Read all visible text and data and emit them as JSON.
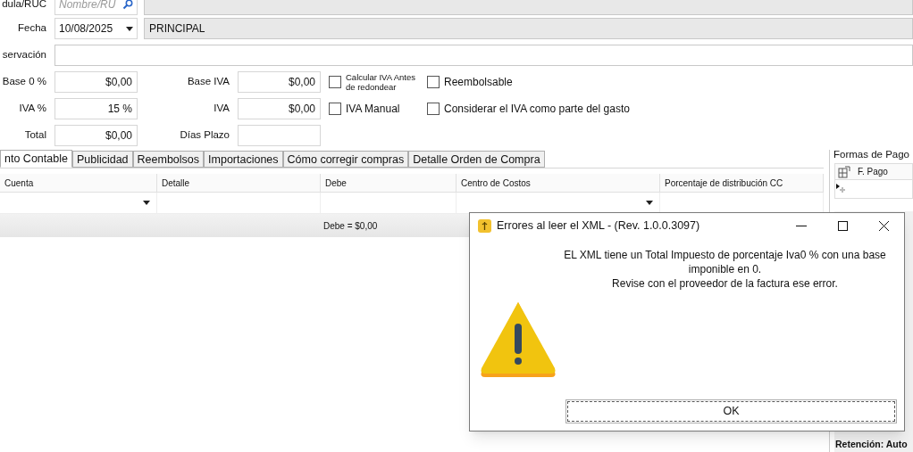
{
  "ruc": {
    "label": "dula/RUC",
    "placeholder": "Nombre/RU"
  },
  "fecha": {
    "label": "Fecha",
    "value": "10/08/2025",
    "branch": "PRINCIPAL"
  },
  "observacion": {
    "label": "servación"
  },
  "amounts": [
    {
      "label": "Base 0 %",
      "value": "$0,00"
    },
    {
      "label": "IVA %",
      "value": "15 %"
    },
    {
      "label": "Total",
      "value": "$0,00"
    }
  ],
  "amounts2": [
    {
      "label": "Base IVA",
      "value": "$0,00"
    },
    {
      "label": "IVA",
      "value": "$0,00"
    },
    {
      "label": "Días Plazo"
    }
  ],
  "checks": [
    {
      "label": "Calcular IVA Antes de redondear",
      "checked": false,
      "kind": "small"
    },
    {
      "label": "Reembolsable",
      "checked": false,
      "kind": "normal"
    },
    {
      "label": "IVA Manual",
      "checked": false,
      "kind": "normal"
    },
    {
      "label": "Considerar el IVA como parte del gasto",
      "checked": false,
      "kind": "normal"
    }
  ],
  "tabs": [
    {
      "label": "nto Contable",
      "selected": true
    },
    {
      "label": "Publicidad",
      "selected": false
    },
    {
      "label": "Reembolsos",
      "selected": false
    },
    {
      "label": "Importaciones",
      "selected": false
    },
    {
      "label": "Cómo corregir compras",
      "selected": false
    },
    {
      "label": "Detalle Orden de Compra",
      "selected": false
    }
  ],
  "grid": {
    "columns": [
      {
        "label": "Cuenta",
        "kind": "combo"
      },
      {
        "label": "Detalle",
        "kind": "text"
      },
      {
        "label": "Debe",
        "kind": "text"
      },
      {
        "label": "Centro de Costos",
        "kind": "combo"
      },
      {
        "label": "Porcentaje de distribución CC",
        "kind": "text"
      }
    ],
    "footer": "Debe = $0,00"
  },
  "payments": {
    "title": "Formas de Pago",
    "column": "F. Pago",
    "retention": "Retención: Auto"
  },
  "dialog": {
    "title": "Errores al leer el XML - (Rev. 1.0.0.3097)",
    "message": [
      "EL XML tiene un Total Impuesto de porcentaje Iva0 % con una base",
      "imponible en 0.",
      "Revise con el proveedor de la factura ese error."
    ],
    "button": "OK"
  }
}
